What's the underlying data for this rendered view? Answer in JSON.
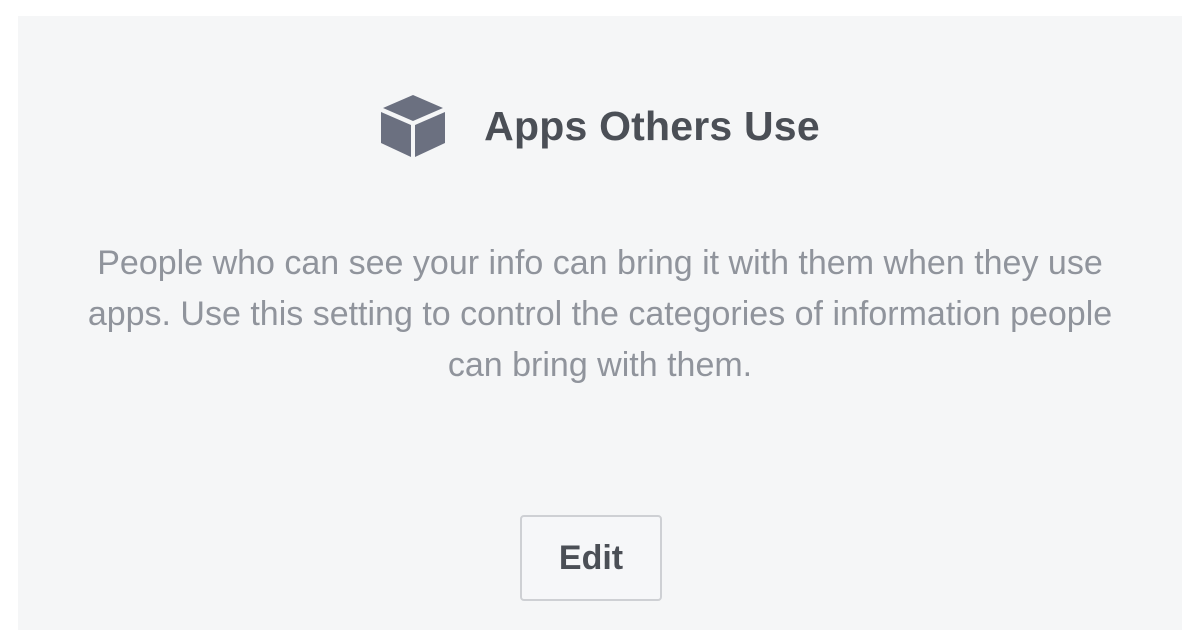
{
  "panel": {
    "icon": "cube-icon",
    "title": "Apps Others Use",
    "description": "People who can see your info can bring it with them when they use apps. Use this setting to control the categories of information people can bring with them.",
    "edit_label": "Edit"
  },
  "colors": {
    "panel_background": "#f5f6f7",
    "title_text": "#4b4f56",
    "description_text": "#90949c",
    "icon_fill": "#6b7080",
    "button_border": "#ced0d4"
  }
}
